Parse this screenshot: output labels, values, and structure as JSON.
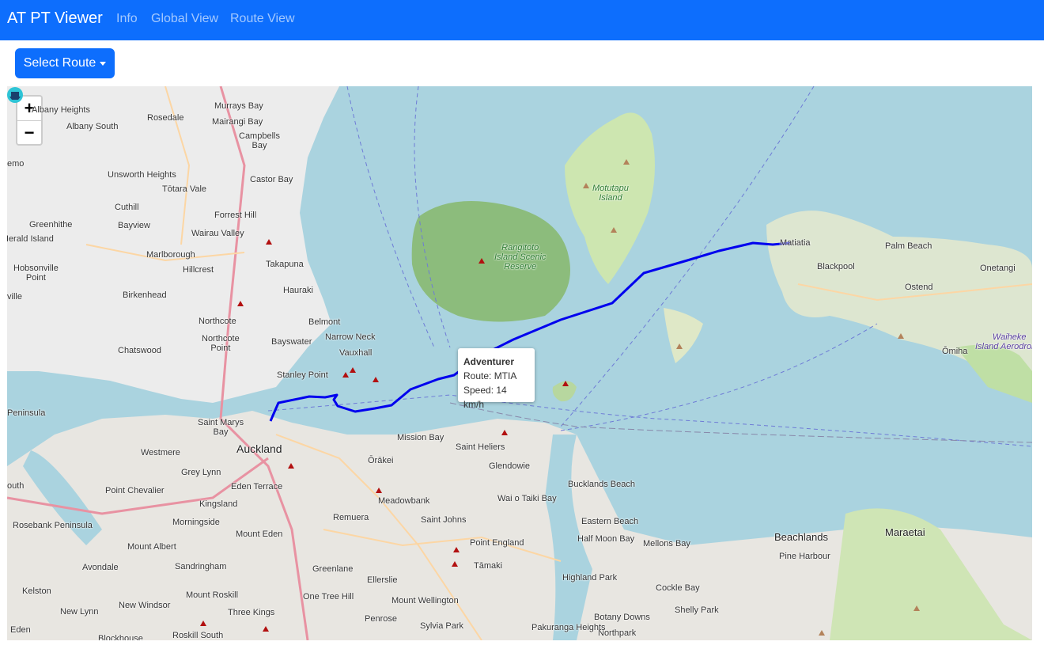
{
  "navbar": {
    "brand": "AT PT Viewer",
    "links": [
      "Info",
      "Global View",
      "Route View"
    ]
  },
  "route_select": {
    "label": "Select Route"
  },
  "map": {
    "zoom_in": "+",
    "zoom_out": "−",
    "popup": {
      "vessel": "Adventurer",
      "route": "Route: MTIA",
      "speed": "Speed: 14 km/h"
    },
    "labels": {
      "auckland": "Auckland",
      "mission_bay": "Mission Bay",
      "saint_heliers": "Saint Heliers",
      "glendowie": "Glendowie",
      "orakei": "Ōrākei",
      "meadowbank": "Meadowbank",
      "remuera": "Remuera",
      "saint_johns": "Saint Johns",
      "point_england": "Point England",
      "tamaki": "Tāmaki",
      "wai_o_taiki": "Wai o Taiki\nBay",
      "bucklands": "Bucklands\nBeach",
      "eastern_beach": "Eastern Beach",
      "half_moon": "Half Moon\nBay",
      "mellons_bay": "Mellons Bay",
      "highland_park": "Highland Park",
      "cockle_bay": "Cockle Bay",
      "shelly_park": "Shelly Park",
      "botany_downs": "Botany Downs",
      "northpark": "Northpark",
      "pakuranga": "Pakuranga\nHeights",
      "beachlands": "Beachlands",
      "pine_harbour": "Pine Harbour",
      "maraetai": "Maraetai",
      "greenlane": "Greenlane",
      "ellerslie": "Ellerslie",
      "one_tree_hill": "One Tree Hill",
      "mount_wellington": "Mount Wellington",
      "penrose": "Penrose",
      "sylvia_park": "Sylvia Park",
      "three_kings": "Three Kings",
      "mount_roskill": "Mount Roskill",
      "roskill_south": "Roskill South",
      "new_windsor": "New Windsor",
      "new_lynn": "New Lynn",
      "kelston": "Kelston",
      "avondale": "Avondale",
      "sandringham": "Sandringham",
      "mount_albert": "Mount Albert",
      "morningside": "Morningside",
      "kingsland": "Kingsland",
      "mount_eden": "Mount Eden",
      "eden_terrace": "Eden Terrace",
      "grey_lynn": "Grey Lynn",
      "westmere": "Westmere",
      "point_chevalier": "Point Chevalier",
      "rosebank": "Rosebank Peninsula",
      "saint_marys_bay": "Saint Marys\nBay",
      "stanley_point": "Stanley Point",
      "vauxhall": "Vauxhall",
      "narrow_neck": "Narrow Neck",
      "bayswater": "Bayswater",
      "belmont": "Belmont",
      "hauraki": "Hauraki",
      "takapuna": "Takapuna",
      "northcote": "Northcote",
      "northcote_point": "Northcote\nPoint",
      "chatswood": "Chatswood",
      "birkenhead": "Birkenhead",
      "hillcrest": "Hillcrest",
      "marlborough": "Marlborough",
      "wairau_valley": "Wairau Valley",
      "forrest_hill": "Forrest Hill",
      "bayview": "Bayview",
      "cuthill": "Cuthill",
      "greenhithe": "Greenhithe",
      "totara_vale": "Tōtara Vale",
      "unsworth_heights": "Unsworth Heights",
      "castor_bay": "Castor Bay",
      "campbells_bay": "Campbells\nBay",
      "mairangi_bay": "Mairangi Bay",
      "murrays_bay": "Murrays Bay",
      "rosedale": "Rosedale",
      "albany_south": "Albany South",
      "albany_heights": "Albany Heights",
      "hobsonville": "Hobsonville\nPoint",
      "herald_island": "Herald Island",
      "rangitoto": "Rangitoto\nIsland Scenic\nReserve",
      "motutapu": "Motutapu\nIsland",
      "matiatia": "Matiatia",
      "blackpool": "Blackpool",
      "palm_beach": "Palm Beach",
      "ostend": "Ostend",
      "onetangi": "Onetangi",
      "omiha": "Ōmiha",
      "waiheke_aerodrome": "Waiheke\nIsland Aerodrome",
      "peninsula": "Peninsula",
      "demo": "emo",
      "ville": "ville",
      "south": "outh",
      "eden": "Eden",
      "blockhouse": "Blockhouse"
    }
  }
}
